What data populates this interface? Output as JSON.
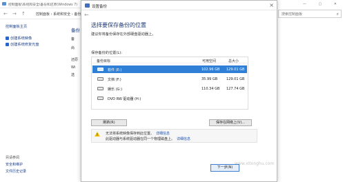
{
  "background_window": {
    "title": "控制面板\\系统和安全\\备份和还原(Windows 7)",
    "nav": {
      "back": "←",
      "forward": "→",
      "up": "↑"
    },
    "breadcrumb": "控制面板 › 系统和安全 › 备份和还原",
    "search_placeholder": "搜索控制面板",
    "sidebar": {
      "home": "控制面板主页",
      "links": [
        "创建系统映像",
        "创建系统修复光盘"
      ],
      "see_also_title": "另请参阅",
      "bottom_links": [
        "安全和维护",
        "文件历史记录"
      ]
    },
    "main": {
      "heading": "备份",
      "lines": [
        "备",
        "尚",
        "还原",
        "Wi",
        "选"
      ]
    }
  },
  "dialog": {
    "title": "设置备份",
    "heading": "选择要保存备份的位置",
    "subtitle": "建议你将备份保存在外部硬盘驱动器上。",
    "list_label": "保存备份的位置(L):",
    "columns": {
      "target": "备份目标",
      "free": "可用空间",
      "total": "总大小"
    },
    "rows": [
      {
        "name": "软件 (E:)",
        "free": "102.96 GB",
        "total": "129.01 GB",
        "selected": true
      },
      {
        "name": "文档 (F:)",
        "free": "35.99 GB",
        "total": "129.01 GB",
        "selected": false
      },
      {
        "name": "娱乐 (G:)",
        "free": "110.34 GB",
        "total": "127.74 GB",
        "selected": false
      },
      {
        "name": "DVD RW 驱动器 (H:)",
        "free": "",
        "total": "",
        "selected": false
      }
    ],
    "refresh_label": "刷新(R)",
    "save_network_label": "保存在网络上(V)...",
    "warning": {
      "line1": "无法将系统映像保存到此位置。",
      "line1_link": "详细信息",
      "line2": "此驱动器与系统驱动器在同一个物理磁盘上。",
      "line2_link": "详细信息"
    },
    "next_label": "下一步(N)"
  },
  "watermark": "www.xitonghu.com"
}
